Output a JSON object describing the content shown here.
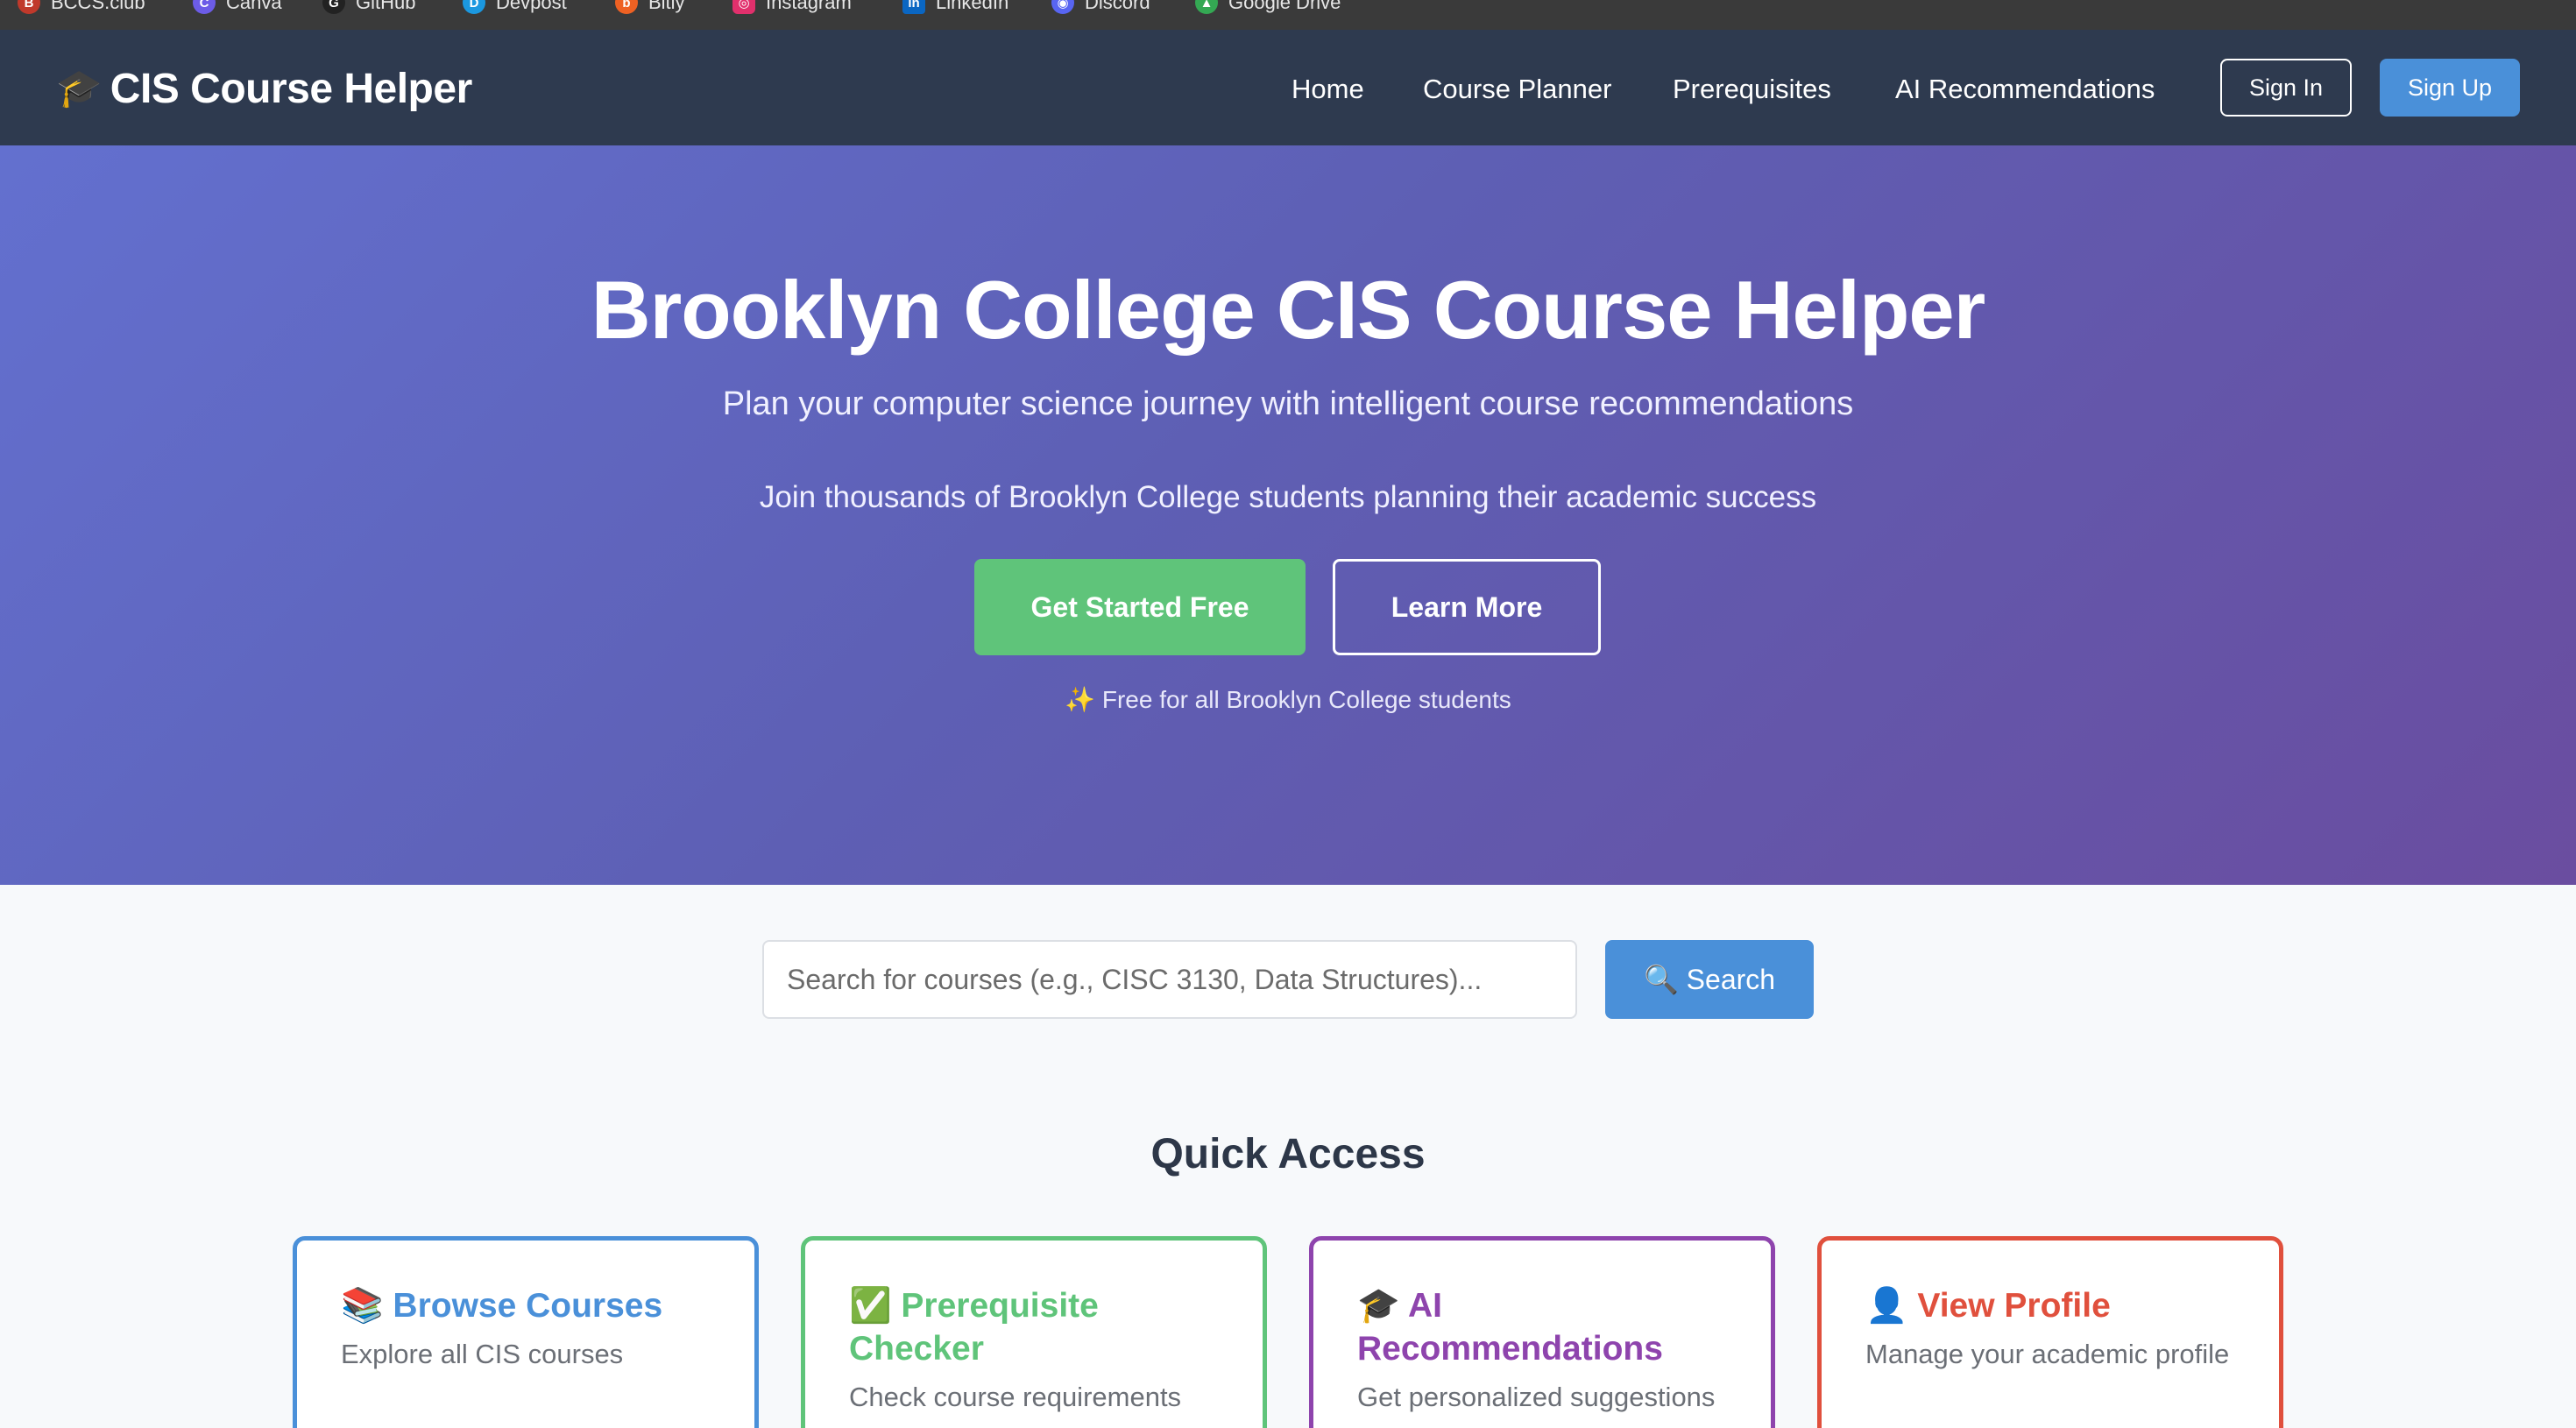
{
  "bookmarks": [
    {
      "label": "BCCS.club",
      "icon": "bccs-icon",
      "color": "#c0392b"
    },
    {
      "label": "Canva",
      "icon": "canva-icon",
      "color": "#6c5ce7"
    },
    {
      "label": "GitHub",
      "icon": "github-icon",
      "color": "#ffffff"
    },
    {
      "label": "Devpost",
      "icon": "devpost-icon",
      "color": "#1b98e0"
    },
    {
      "label": "Bitly",
      "icon": "bitly-icon",
      "color": "#ee6123"
    },
    {
      "label": "Instagram",
      "icon": "instagram-icon",
      "color": "#e1306c"
    },
    {
      "label": "LinkedIn",
      "icon": "linkedin-icon",
      "color": "#0a66c2"
    },
    {
      "label": "Discord",
      "icon": "discord-icon",
      "color": "#5865f2"
    },
    {
      "label": "Google Drive",
      "icon": "google-drive-icon",
      "color": "#34a853"
    }
  ],
  "nav": {
    "brand_icon": "🎓",
    "brand": "CIS Course Helper",
    "links": [
      "Home",
      "Course Planner",
      "Prerequisites",
      "AI Recommendations"
    ],
    "sign_in": "Sign In",
    "sign_up": "Sign Up"
  },
  "hero": {
    "title": "Brooklyn College CIS Course Helper",
    "subtitle": "Plan your computer science journey with intelligent course recommendations",
    "join_text": "Join thousands of Brooklyn College students planning their academic success",
    "primary_cta": "Get Started Free",
    "secondary_cta": "Learn More",
    "note": "✨ Free for all Brooklyn College students"
  },
  "search": {
    "placeholder": "Search for courses (e.g., CISC 3130, Data Structures)...",
    "button": "🔍 Search"
  },
  "quick_access": {
    "title": "Quick Access",
    "cards": [
      {
        "icon": "📚",
        "title": "Browse Courses",
        "desc": "Explore all CIS courses",
        "color": "#4a90d9"
      },
      {
        "icon": "✅",
        "title": "Prerequisite Checker",
        "desc": "Check course requirements",
        "color": "#5fc47a"
      },
      {
        "icon": "🎓",
        "title": "AI Recommendations",
        "desc": "Get personalized suggestions",
        "color": "#8e44ad"
      },
      {
        "icon": "👤",
        "title": "View Profile",
        "desc": "Manage your academic profile",
        "color": "#e0503d"
      }
    ]
  }
}
